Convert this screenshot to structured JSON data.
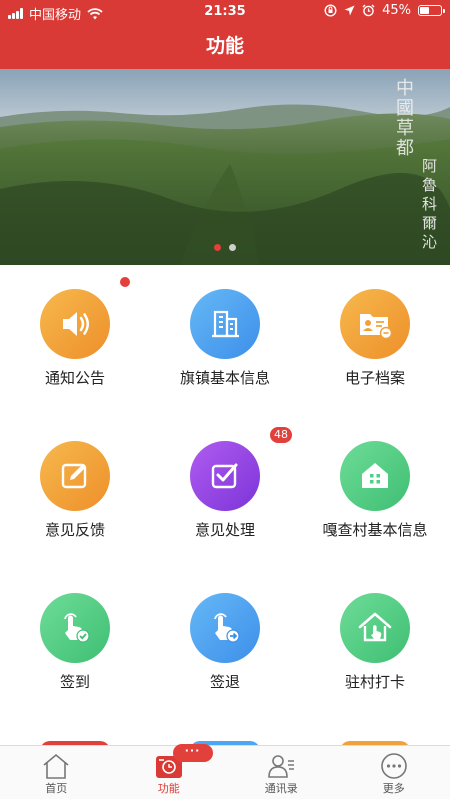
{
  "status_bar": {
    "carrier": "中国移动",
    "time": "21:35",
    "battery": "45%",
    "battery_level": 0.45,
    "icons": [
      "signal-icon",
      "wifi-icon",
      "orientation-lock-icon",
      "location-icon",
      "alarm-icon",
      "battery-icon"
    ]
  },
  "header": {
    "title": "功能"
  },
  "banner": {
    "calligraphy_line1": "中國草都",
    "calligraphy_line2": "阿魯科爾沁",
    "slides": 2,
    "active_slide": 1
  },
  "features": [
    {
      "label": "通知公告",
      "icon": "speaker-icon",
      "color": "#f0a23a",
      "badge": "dot"
    },
    {
      "label": "旗镇基本信息",
      "icon": "buildings-icon",
      "color": "#4da6f2",
      "badge": ""
    },
    {
      "label": "电子档案",
      "icon": "folder-profile-icon",
      "color": "#f0a23a",
      "badge": ""
    },
    {
      "label": "意见反馈",
      "icon": "edit-note-icon",
      "color": "#f0a23a",
      "badge": ""
    },
    {
      "label": "意见处理",
      "icon": "checkbox-icon",
      "color": "#9c45e8",
      "badge": "48"
    },
    {
      "label": "嘎查村基本信息",
      "icon": "house-icon",
      "color": "#4fcf86",
      "badge": ""
    },
    {
      "label": "签到",
      "icon": "tap-check-icon",
      "color": "#4fcf86",
      "badge": ""
    },
    {
      "label": "签退",
      "icon": "tap-arrow-icon",
      "color": "#4da6f2",
      "badge": ""
    },
    {
      "label": "驻村打卡",
      "icon": "house-tap-icon",
      "color": "#4fcf86",
      "badge": ""
    }
  ],
  "tab_bar": {
    "items": [
      {
        "label": "首页",
        "icon": "home-icon",
        "active": false
      },
      {
        "label": "功能",
        "icon": "function-icon",
        "active": true,
        "badge": "···"
      },
      {
        "label": "通讯录",
        "icon": "contacts-icon",
        "active": false
      },
      {
        "label": "更多",
        "icon": "more-icon",
        "active": false
      }
    ]
  },
  "colors": {
    "brand_red": "#d93a35",
    "badge_red": "#e2403b"
  }
}
